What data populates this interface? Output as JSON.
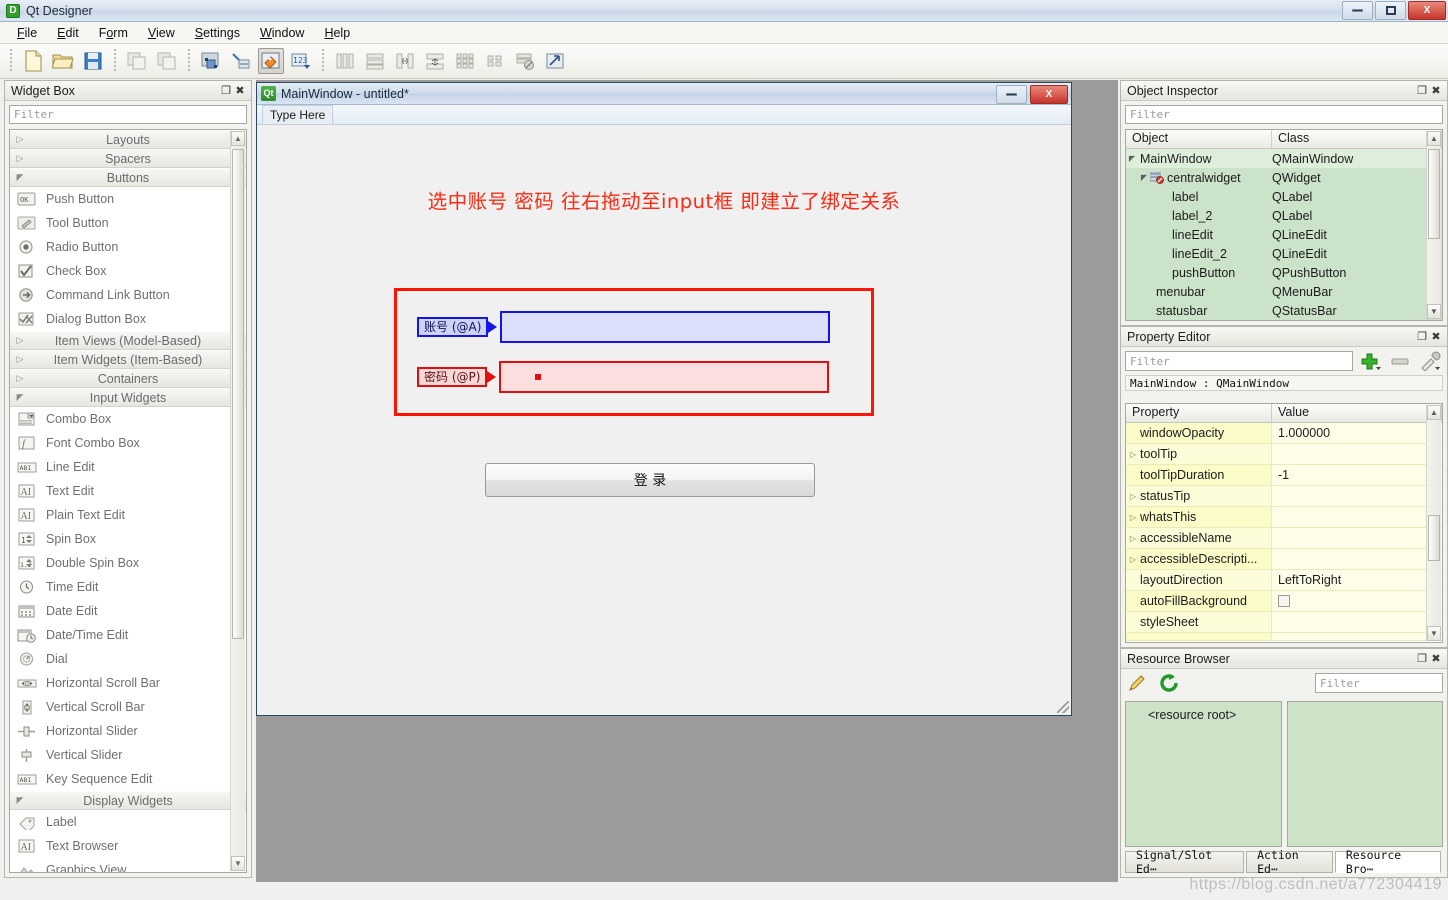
{
  "window": {
    "title": "Qt Designer",
    "app_icon": "qt-designer-icon",
    "minimize_label": "",
    "maximize_label": "",
    "close_label": "X"
  },
  "menubar": {
    "items": [
      {
        "label": "File",
        "mnemonic": "F"
      },
      {
        "label": "Edit",
        "mnemonic": "E"
      },
      {
        "label": "Form",
        "mnemonic": "o"
      },
      {
        "label": "View",
        "mnemonic": "V"
      },
      {
        "label": "Settings",
        "mnemonic": "S"
      },
      {
        "label": "Window",
        "mnemonic": "W"
      },
      {
        "label": "Help",
        "mnemonic": "H"
      }
    ]
  },
  "toolbar": {
    "groups": [
      [
        "new-form-icon",
        "open-form-icon",
        "save-form-icon"
      ],
      [
        "undo-icon",
        "redo-icon"
      ],
      [
        "edit-widgets-icon",
        "edit-signals-slots-icon",
        "edit-buddies-icon",
        "edit-tab-order-icon"
      ],
      [
        "layout-horizontally-icon",
        "layout-vertically-icon",
        "layout-splitter-h-icon",
        "layout-splitter-v-icon",
        "layout-grid-icon",
        "layout-form-icon",
        "break-layout-icon",
        "adjust-size-icon"
      ]
    ],
    "active_tool": "edit-buddies-icon"
  },
  "widget_box": {
    "title": "Widget Box",
    "filter_placeholder": "Filter",
    "sections": [
      {
        "label": "Layouts",
        "expanded": false,
        "items": []
      },
      {
        "label": "Spacers",
        "expanded": false,
        "items": []
      },
      {
        "label": "Buttons",
        "expanded": true,
        "items": [
          {
            "label": "Push Button",
            "icon": "push-button-icon"
          },
          {
            "label": "Tool Button",
            "icon": "tool-button-icon"
          },
          {
            "label": "Radio Button",
            "icon": "radio-button-icon"
          },
          {
            "label": "Check Box",
            "icon": "check-box-icon"
          },
          {
            "label": "Command Link Button",
            "icon": "command-link-button-icon"
          },
          {
            "label": "Dialog Button Box",
            "icon": "dialog-button-box-icon"
          }
        ]
      },
      {
        "label": "Item Views (Model-Based)",
        "expanded": false,
        "items": []
      },
      {
        "label": "Item Widgets (Item-Based)",
        "expanded": false,
        "items": []
      },
      {
        "label": "Containers",
        "expanded": false,
        "items": []
      },
      {
        "label": "Input Widgets",
        "expanded": true,
        "items": [
          {
            "label": "Combo Box",
            "icon": "combo-box-icon"
          },
          {
            "label": "Font Combo Box",
            "icon": "font-combo-box-icon"
          },
          {
            "label": "Line Edit",
            "icon": "line-edit-icon"
          },
          {
            "label": "Text Edit",
            "icon": "text-edit-icon"
          },
          {
            "label": "Plain Text Edit",
            "icon": "plain-text-edit-icon"
          },
          {
            "label": "Spin Box",
            "icon": "spin-box-icon"
          },
          {
            "label": "Double Spin Box",
            "icon": "double-spin-box-icon"
          },
          {
            "label": "Time Edit",
            "icon": "time-edit-icon"
          },
          {
            "label": "Date Edit",
            "icon": "date-edit-icon"
          },
          {
            "label": "Date/Time Edit",
            "icon": "date-time-edit-icon"
          },
          {
            "label": "Dial",
            "icon": "dial-icon"
          },
          {
            "label": "Horizontal Scroll Bar",
            "icon": "horizontal-scroll-bar-icon"
          },
          {
            "label": "Vertical Scroll Bar",
            "icon": "vertical-scroll-bar-icon"
          },
          {
            "label": "Horizontal Slider",
            "icon": "horizontal-slider-icon"
          },
          {
            "label": "Vertical Slider",
            "icon": "vertical-slider-icon"
          },
          {
            "label": "Key Sequence Edit",
            "icon": "key-sequence-edit-icon"
          }
        ]
      },
      {
        "label": "Display Widgets",
        "expanded": true,
        "items": [
          {
            "label": "Label",
            "icon": "label-icon"
          },
          {
            "label": "Text Browser",
            "icon": "text-browser-icon"
          },
          {
            "label": "Graphics View",
            "icon": "graphics-view-icon"
          }
        ]
      }
    ]
  },
  "form": {
    "title": "MainWindow - untitled*",
    "menu_placeholder": "Type Here",
    "hint_text": "选中账号 密码 往右拖动至input框 即建立了绑定关系",
    "hint_color": "#ff2a13",
    "annotation_color": "#ff1400",
    "buddies": [
      {
        "label": "账号 (@A)",
        "field_value": "",
        "color": "#1515e8",
        "fill": "#dde0fb"
      },
      {
        "label": "密码 (@P)",
        "field_value": "•",
        "color": "#e01010",
        "fill": "#fbdede"
      }
    ],
    "login_button": "登 录"
  },
  "object_inspector": {
    "title": "Object Inspector",
    "filter_placeholder": "Filter",
    "columns": [
      "Object",
      "Class"
    ],
    "rows": [
      {
        "object": "MainWindow",
        "class": "QMainWindow",
        "depth": 0,
        "expanded": true,
        "selected": true,
        "icon": ""
      },
      {
        "object": "centralwidget",
        "class": "QWidget",
        "depth": 1,
        "expanded": true,
        "selected": false,
        "icon": "no-layout-icon"
      },
      {
        "object": "label",
        "class": "QLabel",
        "depth": 2,
        "expanded": null,
        "selected": false,
        "icon": ""
      },
      {
        "object": "label_2",
        "class": "QLabel",
        "depth": 2,
        "expanded": null,
        "selected": false,
        "icon": ""
      },
      {
        "object": "lineEdit",
        "class": "QLineEdit",
        "depth": 2,
        "expanded": null,
        "selected": false,
        "icon": ""
      },
      {
        "object": "lineEdit_2",
        "class": "QLineEdit",
        "depth": 2,
        "expanded": null,
        "selected": false,
        "icon": ""
      },
      {
        "object": "pushButton",
        "class": "QPushButton",
        "depth": 2,
        "expanded": null,
        "selected": false,
        "icon": ""
      },
      {
        "object": "menubar",
        "class": "QMenuBar",
        "depth": 1,
        "expanded": null,
        "selected": false,
        "icon": ""
      },
      {
        "object": "statusbar",
        "class": "QStatusBar",
        "depth": 1,
        "expanded": null,
        "selected": false,
        "icon": ""
      }
    ]
  },
  "property_editor": {
    "title": "Property Editor",
    "filter_placeholder": "Filter",
    "add_icon": "add-property-icon",
    "remove_icon": "remove-property-icon",
    "config_icon": "configure-icon",
    "object_line": "MainWindow : QMainWindow",
    "columns": [
      "Property",
      "Value"
    ],
    "rows": [
      {
        "property": "windowOpacity",
        "value": "1.000000",
        "expandable": false
      },
      {
        "property": "toolTip",
        "value": "",
        "expandable": true
      },
      {
        "property": "toolTipDuration",
        "value": "-1",
        "expandable": false
      },
      {
        "property": "statusTip",
        "value": "",
        "expandable": true
      },
      {
        "property": "whatsThis",
        "value": "",
        "expandable": true
      },
      {
        "property": "accessibleName",
        "value": "",
        "expandable": true
      },
      {
        "property": "accessibleDescripti...",
        "value": "",
        "expandable": true
      },
      {
        "property": "layoutDirection",
        "value": "LeftToRight",
        "expandable": false
      },
      {
        "property": "autoFillBackground",
        "value": "",
        "expandable": false,
        "checkbox": true
      },
      {
        "property": "styleSheet",
        "value": "",
        "expandable": false
      }
    ]
  },
  "resource_browser": {
    "title": "Resource Browser",
    "edit_icon": "edit-resources-icon",
    "reload_icon": "reload-icon",
    "filter_placeholder": "Filter",
    "root_label": "<resource root>",
    "tabs": [
      {
        "label": "Signal/Slot Ed⋯",
        "active": false
      },
      {
        "label": "Action Ed⋯",
        "active": false
      },
      {
        "label": "Resource Bro⋯",
        "active": true
      }
    ]
  },
  "watermark": "https://blog.csdn.net/a7723044­19"
}
